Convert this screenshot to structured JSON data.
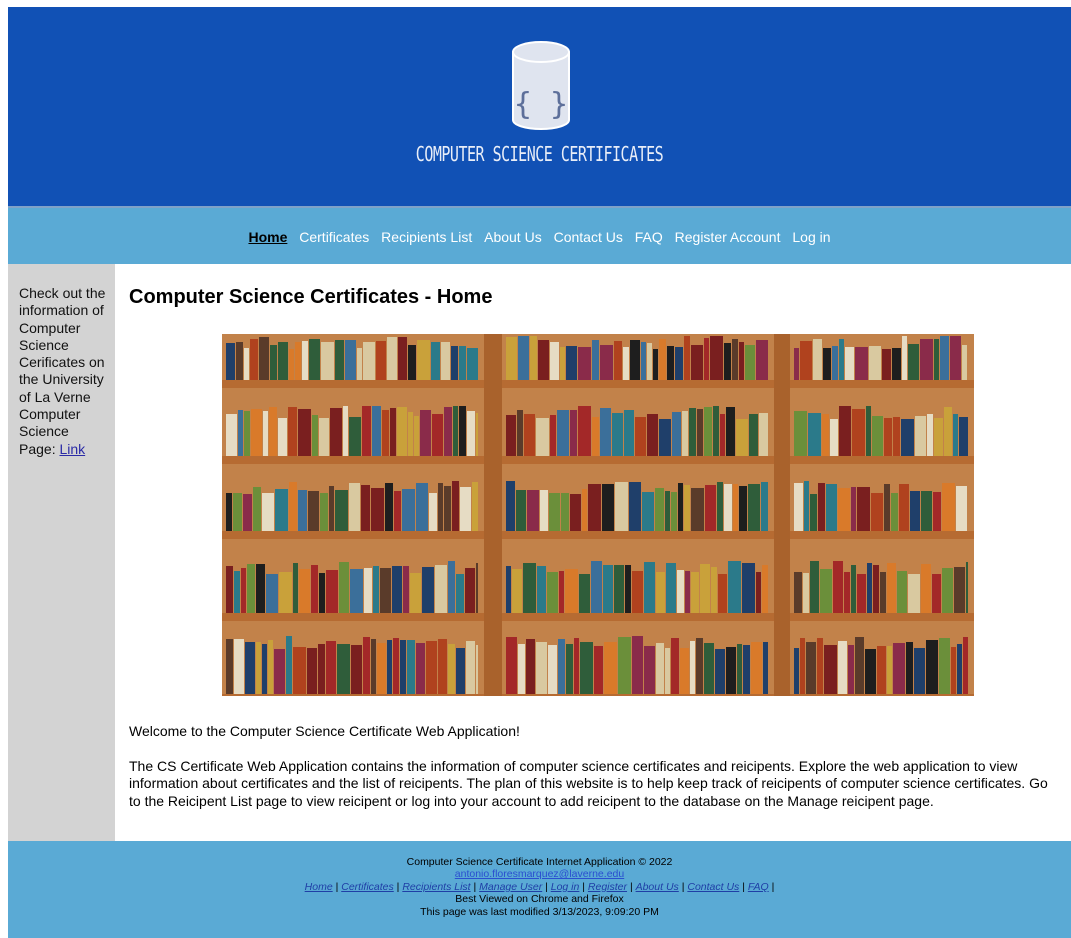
{
  "header": {
    "title": "COMPUTER SCIENCE CERTIFICATES",
    "logo_braces": "{ }",
    "background": "#1151b5"
  },
  "nav": {
    "items": [
      {
        "label": "Home",
        "active": true
      },
      {
        "label": "Certificates"
      },
      {
        "label": "Recipients List"
      },
      {
        "label": "About Us"
      },
      {
        "label": "Contact Us"
      },
      {
        "label": "FAQ"
      },
      {
        "label": "Register Account"
      },
      {
        "label": "Log in"
      }
    ],
    "background": "#5aaad5"
  },
  "sidebar": {
    "text": "Check out the information of Computer Science Cerificates on the University of La Verne Computer Science Page:",
    "link": "Link"
  },
  "main": {
    "title": "Computer Science Certificates - Home",
    "image_alt": "bookshelves-photo",
    "welcome": "Welcome to the Computer Science Certificate Web Application!",
    "description": "The CS Certificate Web Application contains the information of computer science certificates and reicipents. Explore the web application to view information about certificates and the list of reicipents. The plan of this website is to help keep track of reicipents of computer science certificates. Go to the Reicipent List page to view reicipent or log into your account to add reicipent to the database on the Manage reicipent page."
  },
  "footer": {
    "copyright": "Computer Science Certificate Internet Application © 2022",
    "email": "antonio.floresmarquez@laverne.edu",
    "links": [
      "Home",
      "Certificates",
      "Recipients List",
      "Manage User",
      "Log in",
      "Register",
      "About Us",
      "Contact Us",
      "FAQ"
    ],
    "best_viewed": "Best Viewed on Chrome and Firefox",
    "last_modified": "This page was last modified 3/13/2023, 9:09:20 PM"
  }
}
